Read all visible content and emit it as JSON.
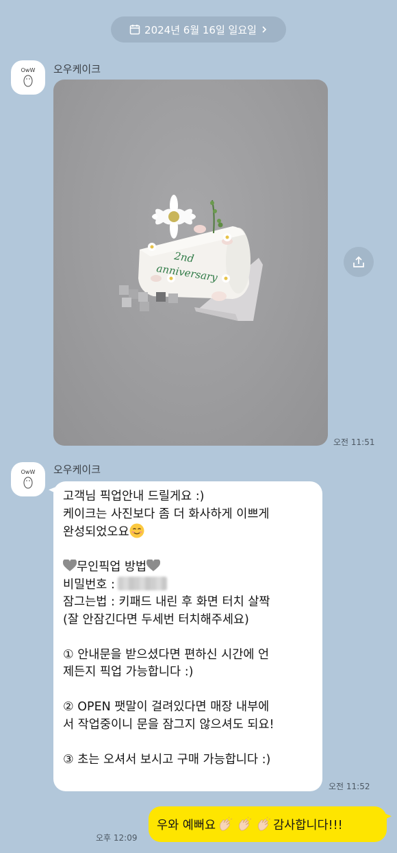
{
  "date_divider": {
    "label": "2024년 6월 16일 일요일",
    "chevron": "chevron-right-icon",
    "icon": "calendar-icon"
  },
  "messages": {
    "first": {
      "sender": "오우케이크",
      "avatar_text": "OwW",
      "time": "오전 11:51",
      "photo_caption_lines": [
        "2nd",
        "anniversary"
      ]
    },
    "second": {
      "sender": "오우케이크",
      "time": "오전 11:52",
      "lines": {
        "l1": "고객님 픽업안내 드릴게요 :)",
        "l2": "케이크는 사진보다 좀 더 화사하게 이쁘게",
        "l3": "완성되었오요",
        "l4": "무인픽업 방법",
        "l5": "비밀번호 :",
        "l6": "잠그는법 : 키패드 내린 후 화면 터치 살짝",
        "l7": "(잘 안잠긴다면 두세번 터치해주세요)",
        "l8": "① 안내문을 받으셨다면 편하신 시간에 언",
        "l9": "제든지 픽업 가능합니다 :)",
        "l10": "② OPEN 팻말이 걸려있다면 매장 내부에",
        "l11": "서 작업중이니 문을 잠그지 않으셔도 되요!",
        "l12": "③ 초는 오셔서 보시고 구매 가능합니다 :)"
      }
    },
    "mine": {
      "text_before": "우와 예뻐요",
      "text_after": "감사합니다!!!",
      "time": "오후 12:09"
    }
  },
  "colors": {
    "background": "#b2c7da",
    "my_bubble": "#fee500",
    "their_bubble": "#ffffff",
    "date_pill": "#9fb3c6"
  }
}
